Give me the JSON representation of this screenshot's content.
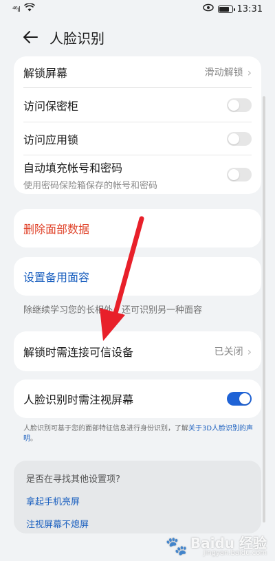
{
  "status_bar": {
    "signal": "⁴⁶ıl",
    "time": "13:31"
  },
  "header": {
    "title": "人脸识别"
  },
  "settings_card": {
    "rows": [
      {
        "title": "解锁屏幕",
        "value": "滑动解锁"
      },
      {
        "title": "访问保密柜",
        "switch_on": false
      },
      {
        "title": "访问应用锁",
        "switch_on": false
      },
      {
        "title": "自动填充帐号和密码",
        "subtitle": "使用密码保险箱保存的帐号和密码",
        "switch_on": false
      }
    ]
  },
  "delete_card": {
    "label": "删除面部数据"
  },
  "backup_card": {
    "label": "设置备用面容"
  },
  "backup_note": "除继续学习您的长相外，还可识别另一种面容",
  "trusted_card": {
    "title": "解锁时需连接可信设备",
    "value": "已关闭"
  },
  "gaze_card": {
    "title": "人脸识别时需注视屏幕",
    "switch_on": true
  },
  "disclaimer": {
    "text": "人脸识别可基于您的面部特征信息进行身份识别，了解",
    "link": "关于3D人脸识别的声明",
    "end": "。"
  },
  "suggest": {
    "title": "是否在寻找其他设置项?",
    "links": [
      "拿起手机亮屏",
      "注视屏幕不熄屏"
    ]
  },
  "watermark": {
    "brand": "Baidu 经验",
    "url": "jingyan.baidu.com"
  },
  "colors": {
    "accent_blue": "#1f63d6",
    "danger_red": "#e0442b",
    "arrow_red": "#e8202a"
  }
}
